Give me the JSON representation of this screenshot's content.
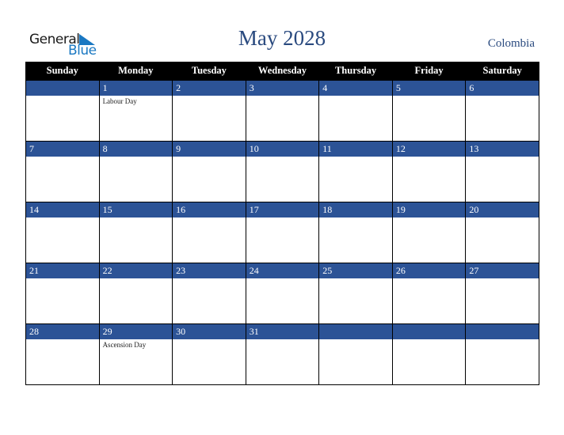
{
  "logo": {
    "line1": "General",
    "line2": "Blue",
    "icon": "triangle-flag-icon"
  },
  "title": "May 2028",
  "country": "Colombia",
  "colors": {
    "header_bg": "#000000",
    "day_bar": "#2c5396",
    "title": "#2a4a7f",
    "logo_blue": "#1a78c2"
  },
  "weekdays": [
    "Sunday",
    "Monday",
    "Tuesday",
    "Wednesday",
    "Thursday",
    "Friday",
    "Saturday"
  ],
  "weeks": [
    [
      {
        "d": ""
      },
      {
        "d": "1",
        "ev": "Labour Day"
      },
      {
        "d": "2"
      },
      {
        "d": "3"
      },
      {
        "d": "4"
      },
      {
        "d": "5"
      },
      {
        "d": "6"
      }
    ],
    [
      {
        "d": "7"
      },
      {
        "d": "8"
      },
      {
        "d": "9"
      },
      {
        "d": "10"
      },
      {
        "d": "11"
      },
      {
        "d": "12"
      },
      {
        "d": "13"
      }
    ],
    [
      {
        "d": "14"
      },
      {
        "d": "15"
      },
      {
        "d": "16"
      },
      {
        "d": "17"
      },
      {
        "d": "18"
      },
      {
        "d": "19"
      },
      {
        "d": "20"
      }
    ],
    [
      {
        "d": "21"
      },
      {
        "d": "22"
      },
      {
        "d": "23"
      },
      {
        "d": "24"
      },
      {
        "d": "25"
      },
      {
        "d": "26"
      },
      {
        "d": "27"
      }
    ],
    [
      {
        "d": "28"
      },
      {
        "d": "29",
        "ev": "Ascension Day"
      },
      {
        "d": "30"
      },
      {
        "d": "31"
      },
      {
        "d": ""
      },
      {
        "d": ""
      },
      {
        "d": ""
      }
    ]
  ]
}
